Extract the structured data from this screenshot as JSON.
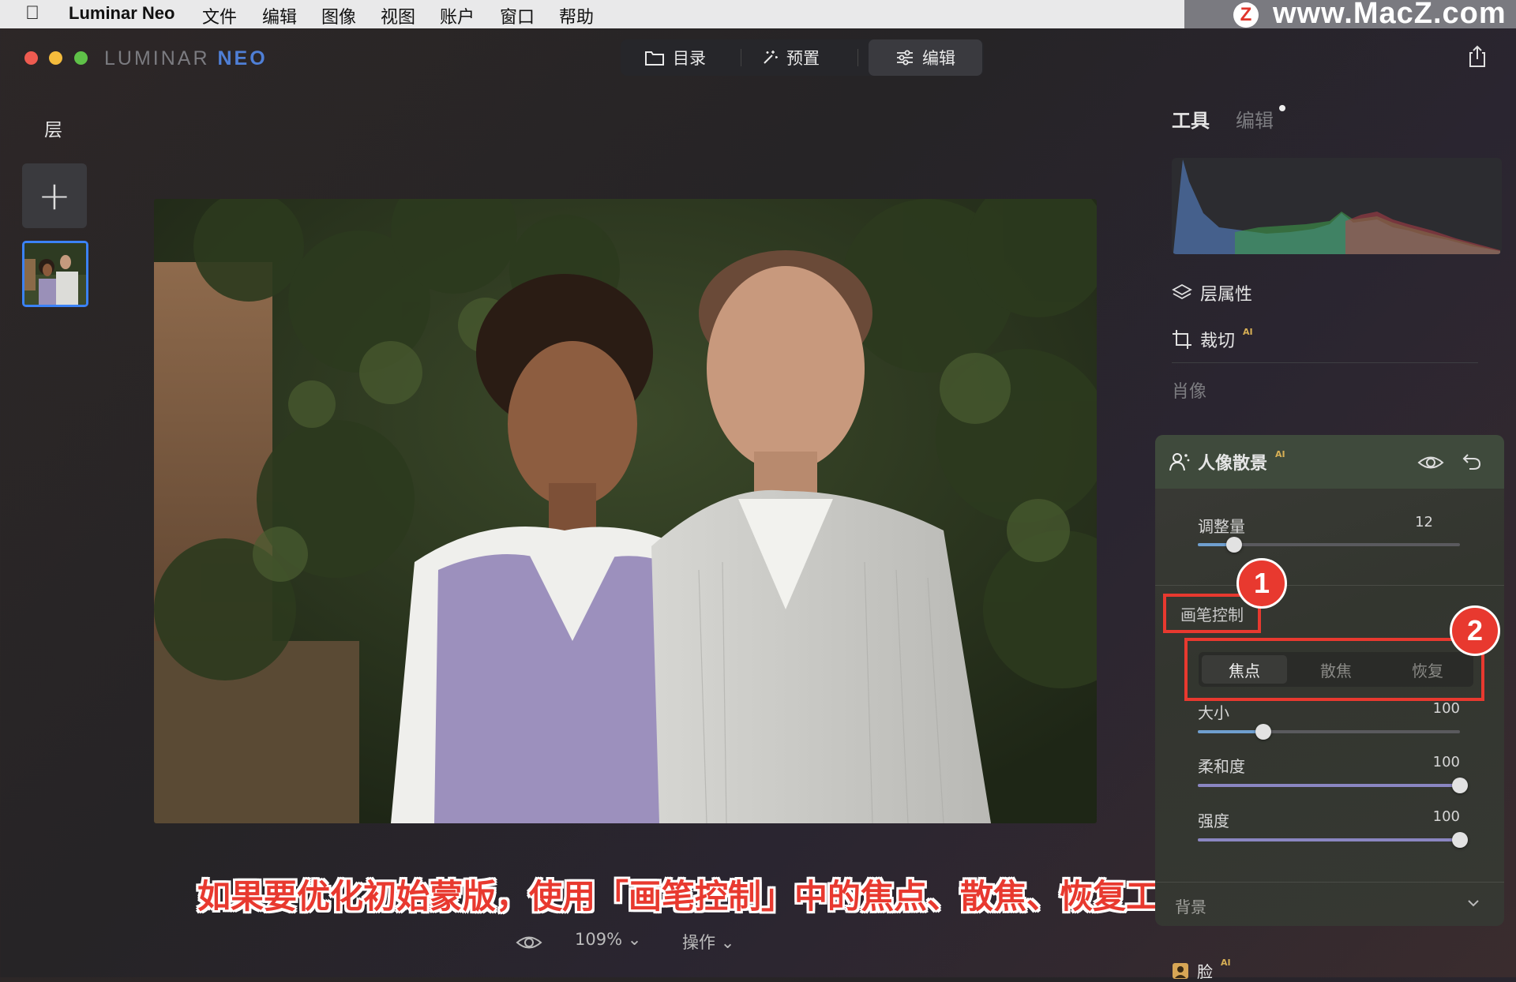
{
  "menubar": {
    "app_name": "Luminar Neo",
    "items": [
      "文件",
      "编辑",
      "图像",
      "视图",
      "账户",
      "窗口",
      "帮助"
    ]
  },
  "watermark": {
    "logo_letter": "Z",
    "text": "www.MacZ.com"
  },
  "titlebar": {
    "brand_light": "LUMINAR ",
    "brand_bold": "NEO",
    "nav": [
      {
        "label": "目录",
        "icon": "folder-icon",
        "active": false
      },
      {
        "label": "预置",
        "icon": "magic-wand-icon",
        "active": false
      },
      {
        "label": "编辑",
        "icon": "sliders-icon",
        "active": true
      }
    ]
  },
  "layers": {
    "title": "层",
    "add_symbol": "+"
  },
  "right_panel": {
    "tab_tools": "工具",
    "tab_edit": "编辑",
    "layer_properties": "层属性",
    "crop": "裁切",
    "crop_badge": "AI",
    "section_portrait": "肖像",
    "bokeh": {
      "title": "人像散景",
      "title_badge": "AI",
      "amount": {
        "label": "调整量",
        "value": "12",
        "fraction": 0.14
      },
      "brush_control_label": "画笔控制",
      "modes": [
        "焦点",
        "散焦",
        "恢复"
      ],
      "active_mode": 0,
      "size": {
        "label": "大小",
        "value": "100",
        "fraction": 0.25
      },
      "softness": {
        "label": "柔和度",
        "value": "100",
        "fraction": 1.0
      },
      "strength": {
        "label": "强度",
        "value": "100",
        "fraction": 1.0
      },
      "background_label": "背景"
    },
    "face": {
      "label": "脸",
      "badge": "AI"
    }
  },
  "annotations": {
    "badge1": "1",
    "badge2": "2"
  },
  "caption": "如果要优化初始蒙版，使用「画笔控制」中的焦点、散焦、恢复工具",
  "bottom_bar": {
    "zoom": "109%",
    "actions": "操作"
  },
  "colors": {
    "accent_blue": "#3b82f6",
    "annotation_red": "#e8392f",
    "ai_badge": "#d8b055"
  }
}
